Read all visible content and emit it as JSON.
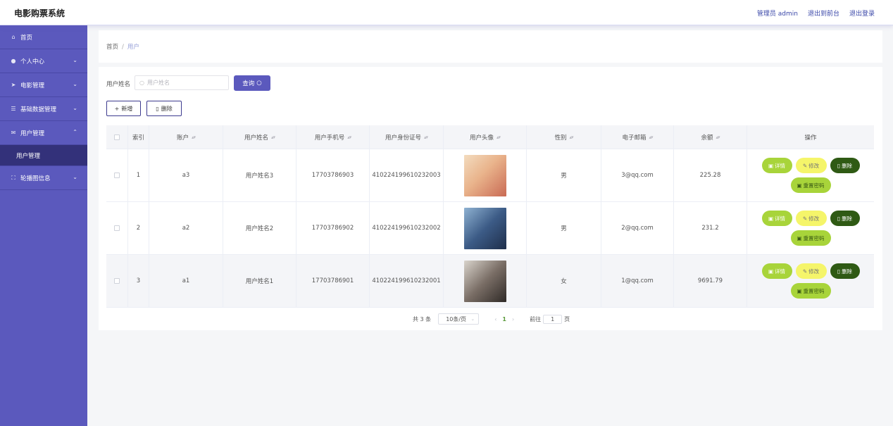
{
  "app_title": "电影购票系统",
  "header": {
    "admin_label": "管理员 admin",
    "front_link": "退出到前台",
    "logout_link": "退出登录"
  },
  "sidebar": {
    "items": [
      {
        "label": "首页",
        "icon": "home-icon",
        "has_chevron": false
      },
      {
        "label": "个人中心",
        "icon": "user-icon",
        "has_chevron": true
      },
      {
        "label": "电影管理",
        "icon": "send-icon",
        "has_chevron": true
      },
      {
        "label": "基础数据管理",
        "icon": "list-icon",
        "has_chevron": true
      },
      {
        "label": "用户管理",
        "icon": "mail-icon",
        "has_chevron": true,
        "expanded": true
      },
      {
        "label": "用户管理",
        "icon": "",
        "sub": true,
        "active": true
      },
      {
        "label": "轮播图信息",
        "icon": "fullscreen-icon",
        "has_chevron": true
      }
    ]
  },
  "breadcrumb": {
    "home": "首页",
    "separator": "/",
    "current": "用户"
  },
  "search": {
    "label": "用户姓名",
    "placeholder": "用户姓名",
    "button": "查询"
  },
  "actions": {
    "add": "新增",
    "delete": "删除"
  },
  "table": {
    "headers": [
      "索引",
      "账户",
      "用户姓名",
      "用户手机号",
      "用户身份证号",
      "用户头像",
      "性别",
      "电子邮箱",
      "余额",
      "操作"
    ],
    "rows": [
      {
        "index": "1",
        "account": "a3",
        "name": "用户姓名3",
        "phone": "17703786903",
        "id_card": "410224199610232003",
        "avatar": "avatar-photo-1",
        "gender": "男",
        "email": "3@qq.com",
        "balance": "225.28"
      },
      {
        "index": "2",
        "account": "a2",
        "name": "用户姓名2",
        "phone": "17703786902",
        "id_card": "410224199610232002",
        "avatar": "avatar-photo-2",
        "gender": "男",
        "email": "2@qq.com",
        "balance": "231.2"
      },
      {
        "index": "3",
        "account": "a1",
        "name": "用户姓名1",
        "phone": "17703786901",
        "id_card": "410224199610232001",
        "avatar": "avatar-photo-3",
        "gender": "女",
        "email": "1@qq.com",
        "balance": "9691.79"
      }
    ],
    "row_actions": {
      "detail": "详情",
      "edit": "修改",
      "delete": "删除",
      "reset": "重置密码"
    }
  },
  "pagination": {
    "total": "共 3 条",
    "page_size": "10条/页",
    "current_page": "1",
    "goto_label": "前往",
    "goto_value": "1",
    "page_suffix": "页"
  },
  "colors": {
    "sidebar_bg": "#5b59bd",
    "primary": "#5b59bd",
    "detail_pill": "#a8d43a",
    "edit_pill": "#f5f56a",
    "delete_pill": "#2f5a14"
  }
}
